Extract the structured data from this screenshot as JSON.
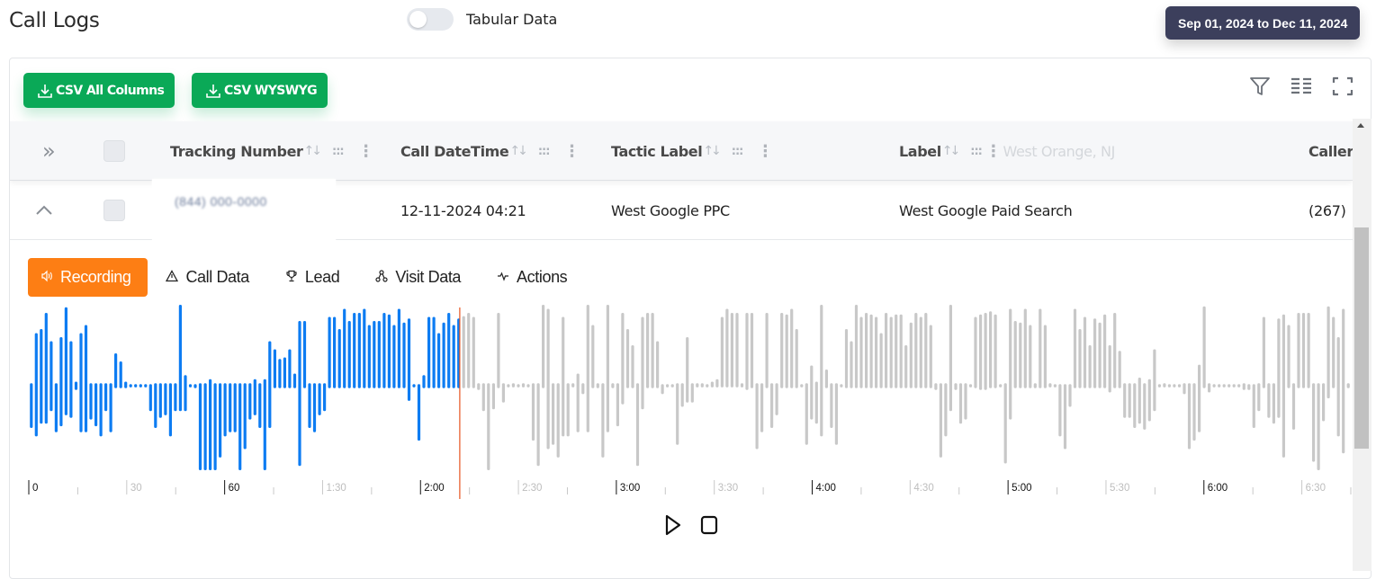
{
  "header": {
    "title": "Call Logs",
    "toggle_label": "Tabular Data",
    "toggle_on": false,
    "date_range": "Sep 01, 2024 to Dec 11, 2024"
  },
  "toolbar": {
    "csv_all_label": "CSV All Columns",
    "csv_wysiwyg_label": "CSV WYSWYG",
    "icons": [
      "filter-icon",
      "columns-icon",
      "fullscreen-icon"
    ]
  },
  "table": {
    "columns": [
      {
        "label": "Tracking Number"
      },
      {
        "label": "Call DateTime"
      },
      {
        "label": "Tactic Label"
      },
      {
        "label": "Label"
      },
      {
        "label": "Caller"
      }
    ],
    "sort_glyph": "↑↓",
    "drag_glyph": ":::",
    "menu_glyph": "⋮",
    "expand_all_glyph": "»",
    "rows": [
      {
        "tracking_number": "(844) 000-0000",
        "call_datetime": "12-11-2024 04:21",
        "tactic_label": "West Google PPC",
        "label": "West Google Paid Search",
        "caller": "(267)"
      }
    ],
    "ghost_text": "West Orange, NJ"
  },
  "detail_tabs": [
    {
      "label": "Recording",
      "icon": "speaker-icon",
      "glyph": "🔊︎",
      "active": true
    },
    {
      "label": "Call Data",
      "icon": "warning-triangle-icon",
      "glyph": "⚠︎",
      "active": false
    },
    {
      "label": "Lead",
      "icon": "trophy-icon",
      "glyph": "🏆︎",
      "active": false
    },
    {
      "label": "Visit Data",
      "icon": "sitemap-icon",
      "glyph": "ஃ",
      "active": false
    },
    {
      "label": "Actions",
      "icon": "activity-icon",
      "glyph": "⁓",
      "active": false
    }
  ],
  "player": {
    "played_fraction": 0.326,
    "played_color": "#0d7cf2",
    "unplayed_color": "#c8c8c8",
    "cursor_color": "#e8541e",
    "timeline_labels": [
      {
        "t": 0,
        "label": "0",
        "major": true
      },
      {
        "t": 30,
        "label": "30",
        "major": false
      },
      {
        "t": 60,
        "label": "60",
        "major": true
      },
      {
        "t": 90,
        "label": "1:30",
        "major": false
      },
      {
        "t": 120,
        "label": "2:00",
        "major": true
      },
      {
        "t": 150,
        "label": "2:30",
        "major": false
      },
      {
        "t": 180,
        "label": "3:00",
        "major": true
      },
      {
        "t": 210,
        "label": "3:30",
        "major": false
      },
      {
        "t": 240,
        "label": "4:00",
        "major": true
      },
      {
        "t": 270,
        "label": "4:30",
        "major": false
      },
      {
        "t": 300,
        "label": "5:00",
        "major": true
      },
      {
        "t": 330,
        "label": "5:30",
        "major": false
      },
      {
        "t": 360,
        "label": "6:00",
        "major": true
      },
      {
        "t": 390,
        "label": "6:30",
        "major": false
      }
    ],
    "visible_duration_seconds": 405,
    "buttons": [
      "play-icon",
      "stop-icon"
    ],
    "peaks": [
      [
        0.03,
        -0.5
      ],
      [
        0.65,
        -0.6
      ],
      [
        0.7,
        -0.45
      ],
      [
        0.9,
        -0.45
      ],
      [
        0.55,
        -0.3
      ],
      [
        0.03,
        -0.55
      ],
      [
        0.6,
        -0.48
      ],
      [
        0.97,
        -0.35
      ],
      [
        0.55,
        -0.38
      ],
      [
        0.05,
        -0.05
      ],
      [
        0.65,
        -0.55
      ],
      [
        0.75,
        -0.55
      ],
      [
        0.03,
        -0.4
      ],
      [
        0.03,
        -0.48
      ],
      [
        0.03,
        -0.6
      ],
      [
        0.03,
        -0.3
      ],
      [
        0.03,
        -0.55
      ],
      [
        0.4,
        -0.03
      ],
      [
        0.3,
        -0.03
      ],
      [
        0.05,
        -0.03
      ],
      [
        0.02,
        -0.02
      ],
      [
        0.02,
        -0.02
      ],
      [
        0.02,
        -0.02
      ],
      [
        0.02,
        -0.02
      ],
      [
        0.02,
        -0.3
      ],
      [
        0.03,
        -0.5
      ],
      [
        0.03,
        -0.38
      ],
      [
        0.03,
        -0.35
      ],
      [
        0.03,
        -0.6
      ],
      [
        0.03,
        -0.3
      ],
      [
        1.0,
        -0.3
      ],
      [
        0.13,
        -0.3
      ],
      [
        0.02,
        -0.02
      ],
      [
        0.02,
        -0.03
      ],
      [
        0.03,
        -1.0
      ],
      [
        0.03,
        -1.0
      ],
      [
        0.08,
        -1.0
      ],
      [
        0.03,
        -1.0
      ],
      [
        0.03,
        -0.85
      ],
      [
        0.03,
        -0.6
      ],
      [
        0.03,
        -0.55
      ],
      [
        0.03,
        -0.55
      ],
      [
        0.03,
        -1.0
      ],
      [
        0.03,
        -0.75
      ],
      [
        0.03,
        -0.4
      ],
      [
        0.08,
        -0.35
      ],
      [
        0.03,
        -0.5
      ],
      [
        0.08,
        -1.0
      ],
      [
        0.55,
        -0.5
      ],
      [
        0.45,
        -0.03
      ],
      [
        0.33,
        -0.03
      ],
      [
        0.35,
        -0.03
      ],
      [
        0.45,
        -0.03
      ],
      [
        0.15,
        -0.03
      ],
      [
        0.8,
        -0.95
      ],
      [
        0.8,
        -0.03
      ],
      [
        0.03,
        -0.5
      ],
      [
        0.03,
        -0.55
      ],
      [
        0.03,
        -0.35
      ],
      [
        0.03,
        -0.3
      ],
      [
        0.85,
        -0.03
      ],
      [
        0.85,
        -0.03
      ],
      [
        0.7,
        -0.03
      ],
      [
        0.95,
        -0.03
      ],
      [
        0.8,
        -0.03
      ],
      [
        0.9,
        -0.03
      ],
      [
        0.9,
        -0.03
      ],
      [
        0.95,
        -0.03
      ],
      [
        0.75,
        -0.03
      ],
      [
        0.8,
        -0.03
      ],
      [
        0.8,
        -0.03
      ],
      [
        0.9,
        -0.03
      ],
      [
        0.88,
        -0.03
      ],
      [
        0.75,
        -0.03
      ],
      [
        0.95,
        -0.03
      ],
      [
        0.78,
        -0.03
      ],
      [
        0.83,
        -0.18
      ],
      [
        0.02,
        -0.02
      ],
      [
        0.02,
        -0.65
      ],
      [
        0.13,
        -0.03
      ],
      [
        0.85,
        -0.03
      ],
      [
        0.85,
        -0.03
      ],
      [
        0.65,
        -0.03
      ],
      [
        0.78,
        -0.03
      ],
      [
        0.9,
        -0.03
      ],
      [
        0.75,
        -0.03
      ],
      [
        0.83,
        -0.03
      ],
      [
        0.86,
        -0.03
      ],
      [
        0.9,
        -0.03
      ],
      [
        0.85,
        -0.03
      ],
      [
        0.03,
        -0.05
      ],
      [
        0.03,
        -0.3
      ],
      [
        0.03,
        -1.0
      ],
      [
        0.03,
        -0.28
      ],
      [
        0.9,
        -0.03
      ],
      [
        0.03,
        -0.2
      ],
      [
        0.02,
        -0.02
      ],
      [
        0.03,
        -0.02
      ],
      [
        0.02,
        -0.02
      ],
      [
        0.03,
        -0.02
      ],
      [
        0.02,
        -0.02
      ],
      [
        0.03,
        -0.65
      ],
      [
        0.03,
        -0.95
      ],
      [
        1.0,
        -0.03
      ],
      [
        0.95,
        -0.75
      ],
      [
        0.03,
        -0.7
      ],
      [
        0.03,
        -0.85
      ],
      [
        0.85,
        -0.6
      ],
      [
        0.03,
        -0.6
      ],
      [
        0.03,
        -0.02
      ],
      [
        0.15,
        -0.55
      ],
      [
        0.03,
        -0.1
      ],
      [
        1.0,
        -0.55
      ],
      [
        0.75,
        -0.03
      ],
      [
        0.03,
        -0.03
      ],
      [
        0.03,
        -0.85
      ],
      [
        1.0,
        -0.55
      ],
      [
        0.03,
        -0.03
      ],
      [
        0.03,
        -0.48
      ],
      [
        0.9,
        -0.22
      ],
      [
        0.7,
        -0.03
      ],
      [
        0.5,
        -0.03
      ],
      [
        0.03,
        -0.95
      ],
      [
        0.85,
        -0.28
      ],
      [
        0.9,
        -0.03
      ],
      [
        0.9,
        -0.03
      ],
      [
        0.55,
        -0.03
      ],
      [
        0.02,
        -0.1
      ],
      [
        0.02,
        -0.02
      ],
      [
        0.02,
        -0.02
      ],
      [
        0.03,
        -0.7
      ],
      [
        0.03,
        -0.25
      ],
      [
        0.6,
        -0.2
      ],
      [
        0.03,
        -0.2
      ],
      [
        0.03,
        -0.02
      ],
      [
        0.03,
        -0.02
      ],
      [
        0.02,
        -0.02
      ],
      [
        0.05,
        -0.02
      ],
      [
        0.08,
        -0.02
      ],
      [
        0.85,
        -0.02
      ],
      [
        0.95,
        -0.02
      ],
      [
        0.9,
        -0.02
      ],
      [
        0.9,
        -0.02
      ],
      [
        0.03,
        -0.02
      ],
      [
        0.9,
        -0.05
      ],
      [
        0.9,
        -0.03
      ],
      [
        0.03,
        -0.75
      ],
      [
        0.03,
        -0.55
      ],
      [
        0.9,
        -0.03
      ],
      [
        0.03,
        -0.5
      ],
      [
        0.03,
        -0.35
      ],
      [
        0.9,
        -0.03
      ],
      [
        0.88,
        -0.03
      ],
      [
        0.95,
        -0.03
      ],
      [
        0.7,
        -0.03
      ],
      [
        0.02,
        -0.02
      ],
      [
        0.03,
        -0.7
      ],
      [
        0.25,
        -0.4
      ],
      [
        0.05,
        -0.45
      ],
      [
        1.0,
        -0.6
      ],
      [
        0.2,
        -0.03
      ],
      [
        0.03,
        -0.5
      ],
      [
        0.03,
        -0.7
      ],
      [
        0.02,
        -0.02
      ],
      [
        0.7,
        -0.03
      ],
      [
        0.55,
        -0.03
      ],
      [
        1.0,
        -0.03
      ],
      [
        0.85,
        -0.03
      ],
      [
        0.9,
        -0.03
      ],
      [
        0.88,
        -0.03
      ],
      [
        0.85,
        -0.03
      ],
      [
        0.65,
        -0.03
      ],
      [
        0.9,
        -0.03
      ],
      [
        0.85,
        -0.03
      ],
      [
        0.88,
        -0.03
      ],
      [
        0.88,
        -0.03
      ],
      [
        0.5,
        -0.03
      ],
      [
        0.78,
        -0.03
      ],
      [
        0.9,
        -0.03
      ],
      [
        0.85,
        -0.03
      ],
      [
        0.9,
        -0.03
      ],
      [
        0.75,
        -0.03
      ],
      [
        0.03,
        -0.05
      ],
      [
        0.03,
        -0.85
      ],
      [
        0.03,
        -0.6
      ],
      [
        1.0,
        -0.3
      ],
      [
        0.03,
        -0.05
      ],
      [
        0.03,
        -0.45
      ],
      [
        0.03,
        -0.4
      ],
      [
        0.02,
        -0.02
      ],
      [
        0.85,
        -0.03
      ],
      [
        0.88,
        -0.05
      ],
      [
        0.9,
        -0.05
      ],
      [
        0.92,
        -0.03
      ],
      [
        0.88,
        -0.03
      ],
      [
        0.02,
        -0.02
      ],
      [
        0.03,
        -0.92
      ],
      [
        0.95,
        -0.4
      ],
      [
        0.8,
        -0.03
      ],
      [
        0.78,
        -0.03
      ],
      [
        0.95,
        -0.03
      ],
      [
        0.75,
        -0.03
      ],
      [
        0.03,
        -0.03
      ],
      [
        0.95,
        -0.03
      ],
      [
        0.75,
        -0.03
      ],
      [
        0.03,
        -0.02
      ],
      [
        0.02,
        -0.02
      ],
      [
        0.02,
        -0.6
      ],
      [
        0.02,
        -0.75
      ],
      [
        0.02,
        -0.25
      ],
      [
        0.95,
        -0.03
      ],
      [
        0.7,
        -0.03
      ],
      [
        0.85,
        -0.03
      ],
      [
        0.5,
        -0.03
      ],
      [
        0.83,
        -0.03
      ],
      [
        0.78,
        -0.03
      ],
      [
        0.88,
        -0.03
      ],
      [
        0.5,
        -0.08
      ],
      [
        0.9,
        -0.03
      ],
      [
        0.43,
        -0.03
      ],
      [
        0.03,
        -0.38
      ],
      [
        0.03,
        -0.38
      ],
      [
        0.03,
        -0.5
      ],
      [
        0.1,
        -0.45
      ],
      [
        0.03,
        -0.52
      ],
      [
        0.08,
        -0.42
      ],
      [
        0.45,
        -0.3
      ],
      [
        0.02,
        -0.02
      ],
      [
        0.03,
        -0.02
      ],
      [
        0.02,
        -0.02
      ],
      [
        0.02,
        -0.02
      ],
      [
        0.02,
        -0.02
      ],
      [
        0.03,
        -0.1
      ],
      [
        0.03,
        -0.75
      ],
      [
        0.03,
        -0.65
      ],
      [
        0.26,
        -0.55
      ],
      [
        0.98,
        -0.03
      ],
      [
        0.03,
        -0.08
      ],
      [
        0.02,
        -0.02
      ],
      [
        0.02,
        -0.02
      ],
      [
        0.02,
        -0.02
      ],
      [
        0.02,
        -0.02
      ],
      [
        0.02,
        -0.02
      ],
      [
        0.02,
        -0.02
      ],
      [
        0.03,
        -0.05
      ],
      [
        0.02,
        -0.05
      ],
      [
        0.02,
        -0.5
      ],
      [
        0.03,
        -0.3
      ],
      [
        0.85,
        -0.03
      ],
      [
        0.03,
        -0.38
      ],
      [
        0.03,
        -0.45
      ],
      [
        0.83,
        -0.38
      ],
      [
        0.88,
        -0.85
      ],
      [
        0.75,
        -0.03
      ],
      [
        0.03,
        -0.52
      ],
      [
        0.9,
        -0.03
      ],
      [
        0.9,
        -0.03
      ],
      [
        0.9,
        -0.03
      ],
      [
        0.03,
        -0.9
      ],
      [
        0.03,
        -1.0
      ],
      [
        0.03,
        -0.42
      ],
      [
        0.98,
        -0.15
      ],
      [
        0.85,
        -0.03
      ],
      [
        0.6,
        -0.6
      ],
      [
        0.95,
        -0.8
      ],
      [
        0.03,
        -0.03
      ]
    ]
  }
}
